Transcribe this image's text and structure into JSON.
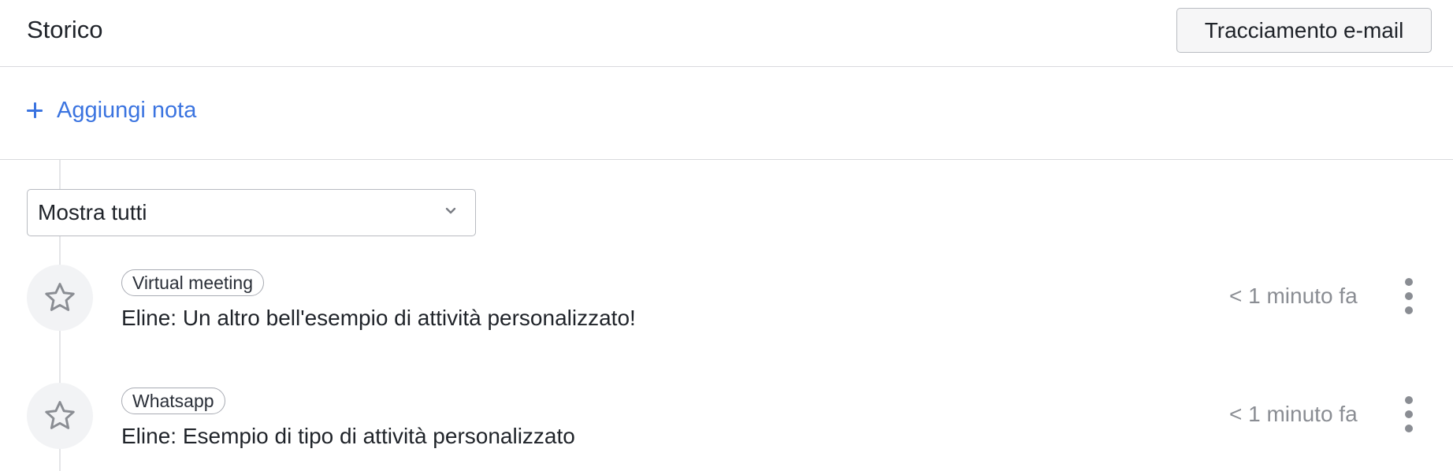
{
  "header": {
    "title": "Storico",
    "track_button": "Tracciamento e-mail"
  },
  "add_note": {
    "label": "Aggiungi nota",
    "icon": "plus-icon"
  },
  "filter": {
    "selected": "Mostra tutti",
    "icon": "chevron-down-icon"
  },
  "activities": [
    {
      "tag": "Virtual meeting",
      "description": "Eline: Un altro bell'esempio di attività personalizzato!",
      "time": "< 1 minuto fa",
      "icon": "star-icon"
    },
    {
      "tag": "Whatsapp",
      "description": "Eline: Esempio di tipo di attività personalizzato",
      "time": "< 1 minuto fa",
      "icon": "star-icon"
    }
  ],
  "colors": {
    "accent": "#3b74e0",
    "muted_text": "#8a8d93",
    "border": "#d9dadd"
  }
}
